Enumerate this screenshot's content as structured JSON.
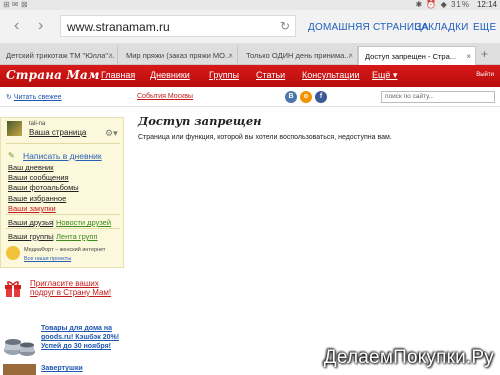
{
  "statusbar": {
    "left": "⊞ ✉ ⊠",
    "icons": "✱ ⏰ ◆ 31%",
    "time": "12:14"
  },
  "browser": {
    "url": "www.stranamam.ru",
    "home": "ДОМАШНЯЯ СТРАНИЦА",
    "bookmarks": "ЗАКЛАДКИ",
    "more": "ЕЩЕ"
  },
  "tabs": [
    {
      "label": "Детский трикотаж ТМ \"Юлла\"..."
    },
    {
      "label": "Мир пряжи (заказ пряжи МО..."
    },
    {
      "label": "Только ОДИН день принима..."
    },
    {
      "label": "Доступ запрещен - Стра..."
    }
  ],
  "site": {
    "logo": "Страна Мам",
    "nav": [
      "Главная",
      "Дневники",
      "Группы",
      "Статьи",
      "Консультации",
      "Ещё ▾"
    ],
    "exit": "Выйти",
    "read_fresh": "Читать свежее",
    "events": "События Москвы",
    "search_placeholder": "поиск по сайту..."
  },
  "sidebar": {
    "username": "tali-na",
    "my_page": "Ваша страница",
    "write": "Написать в дневник",
    "links": [
      "Ваш дневник",
      "Ваши сообщения",
      "Ваши фотоальбомы",
      "Ваше избранное",
      "Ваши закупки"
    ],
    "friends": "Ваши друзья",
    "friends_news": "Новости друзей",
    "groups": "Ваши группы",
    "groups_feed": "Лента групп",
    "media": "МедиаФорт – женский интернет",
    "all_projects": "Все наши проекты"
  },
  "invite": "Пригласите ваших подруг в Страну Мам!",
  "promo1": "Товары для дома на goods.ru! Кэшбэк 20%! Успей до 30 ноября!",
  "promo2": "Завертушки",
  "main": {
    "title": "Доступ запрещен",
    "text": "Страница или функция, которой вы хотели воспользоваться, недоступна вам."
  },
  "watermark": "ДелаемПокупки.Ру",
  "colors": {
    "header_red": "#cc1111",
    "link_blue": "#2a61b8",
    "sidebar_bg": "#fcf8dc"
  }
}
